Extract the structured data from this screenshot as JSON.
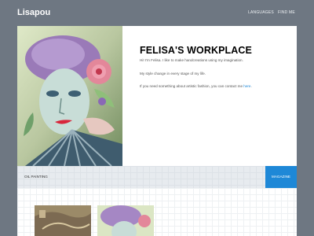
{
  "header": {
    "brand": "Lisapou",
    "nav": [
      "LANGUAGES",
      "FIND ME"
    ]
  },
  "hero": {
    "title": "FELISA'S WORKPLACE",
    "intro": "Hi! I'm Felisa. I like to make handcreations using my imagination.",
    "style": "My style change in every stage of my life.",
    "contact_prefix": "If you need something about artistic fashion, you can contact me ",
    "contact_link": "here",
    "contact_suffix": ".",
    "image_icon": "painting-image"
  },
  "tabs": {
    "left": "OIL PAINTING",
    "right": "MAGAZINE"
  },
  "gallery": {
    "thumbnails": [
      "painting-thumbnail",
      "painting-thumbnail"
    ]
  },
  "colors": {
    "background": "#6e7782",
    "accent": "#1e88d7",
    "link": "#1c86d6"
  }
}
